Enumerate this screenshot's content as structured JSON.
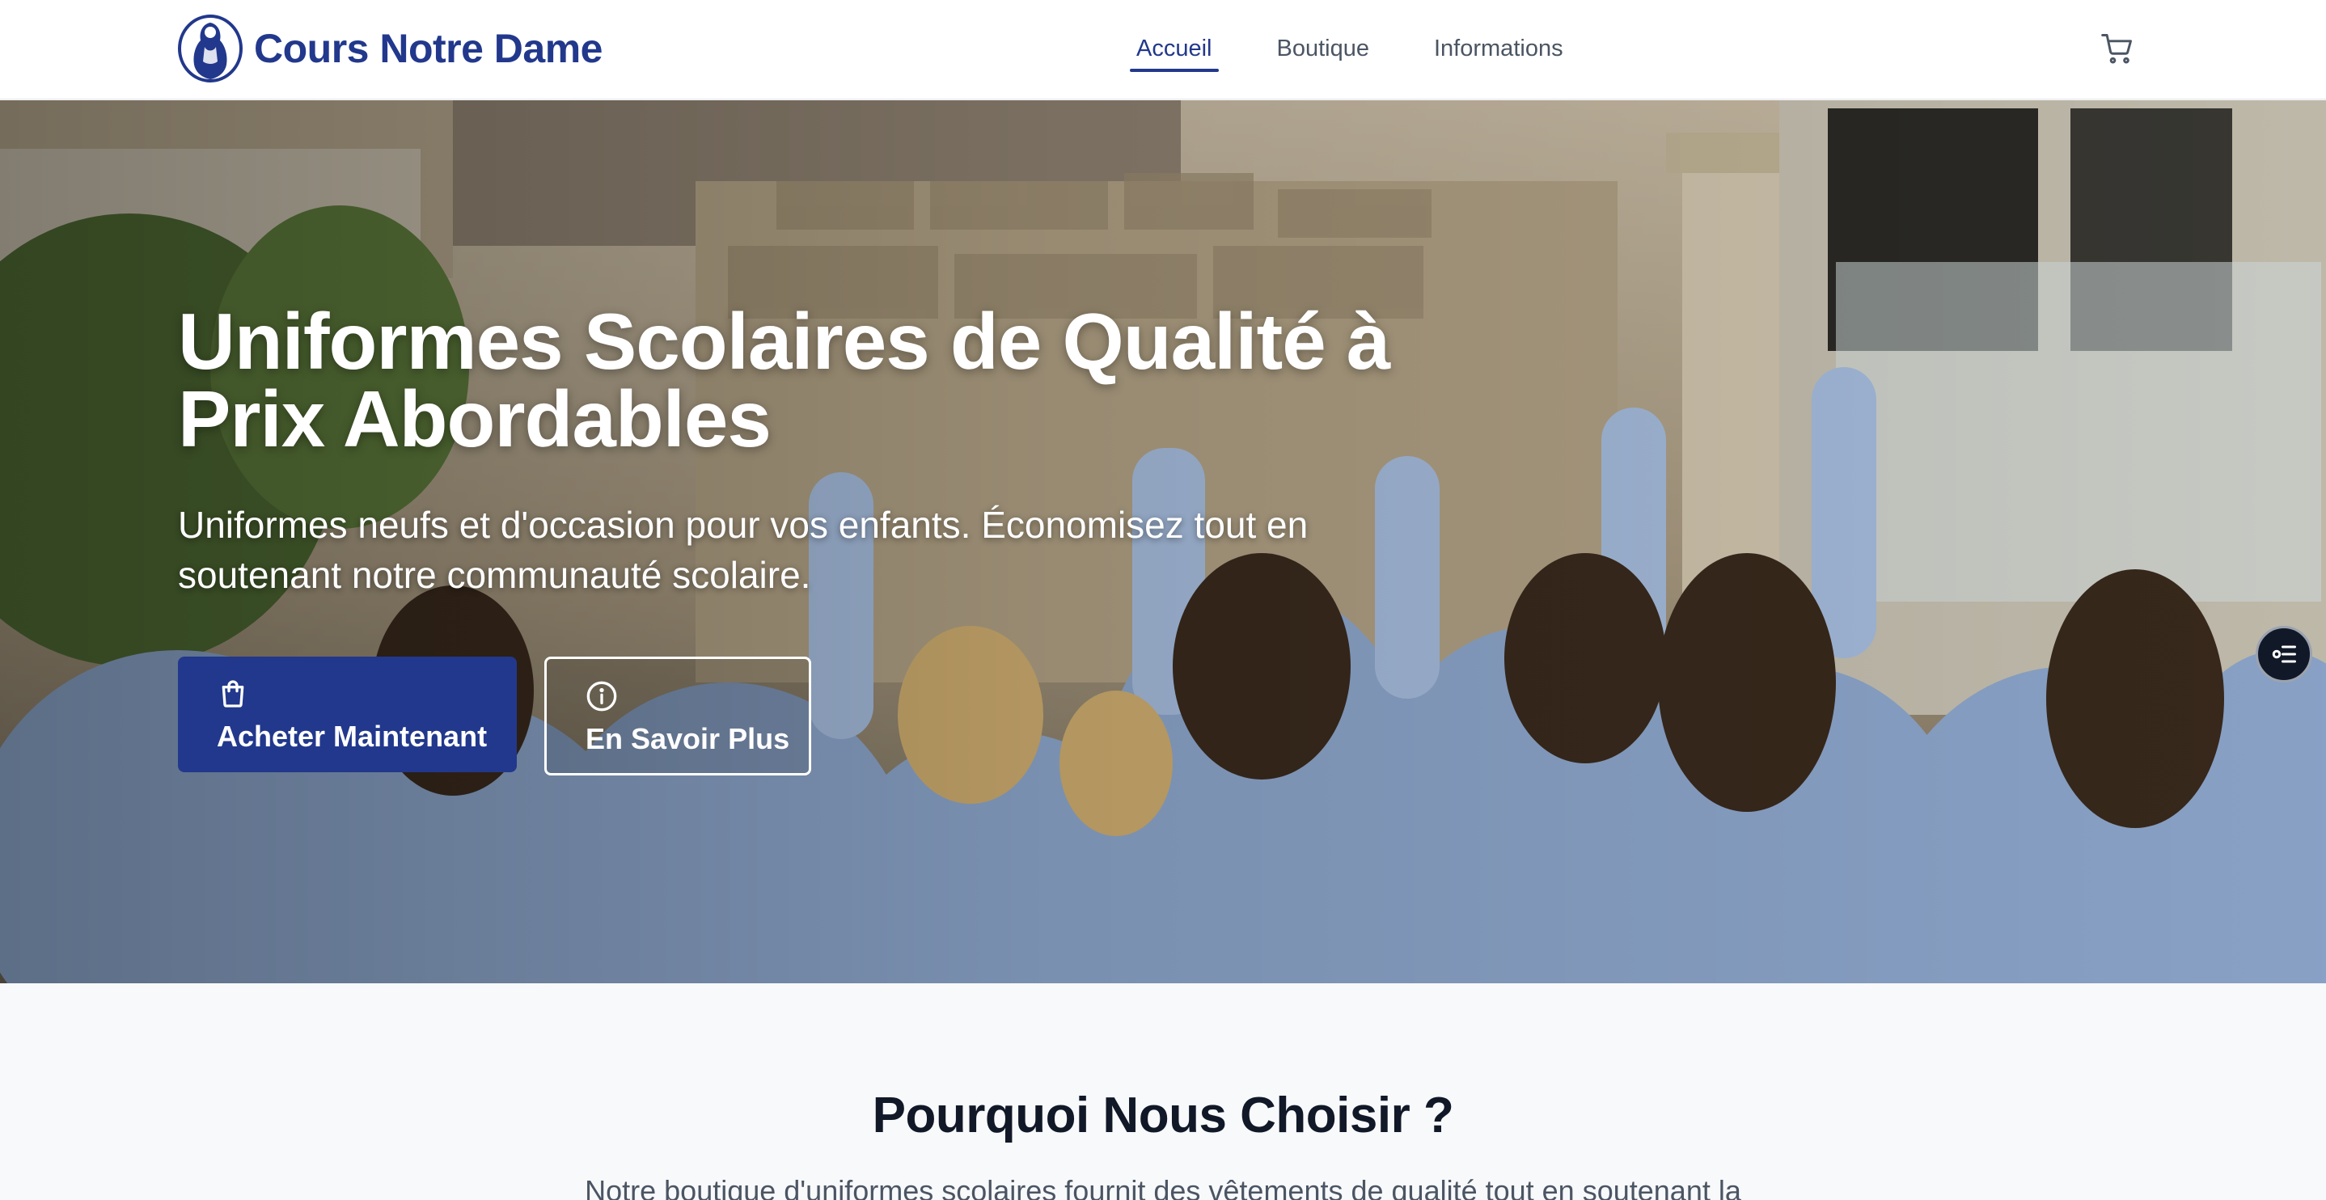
{
  "brand": {
    "name": "Cours Notre Dame",
    "logo_icon": "madonna-logo-icon",
    "color": "#22388c"
  },
  "nav": {
    "items": [
      {
        "label": "Accueil",
        "active": true
      },
      {
        "label": "Boutique",
        "active": false
      },
      {
        "label": "Informations",
        "active": false
      }
    ],
    "cart_icon": "cart-icon"
  },
  "hero": {
    "title": "Uniformes Scolaires de Qualité à Prix Abordables",
    "subtitle": "Uniformes neufs et d'occasion pour vos enfants. Économisez tout en soutenant notre communauté scolaire.",
    "primary_button": {
      "label": "Acheter Maintenant",
      "icon": "shopping-bag-icon"
    },
    "secondary_button": {
      "label": "En Savoir Plus",
      "icon": "info-icon"
    },
    "background_description_icon": "students-courtyard-photo",
    "fab_icon": "filter-list-icon"
  },
  "why": {
    "title": "Pourquoi Nous Choisir ?",
    "text": "Notre boutique d'uniformes scolaires fournit des vêtements de qualité tout en soutenant la"
  },
  "colors": {
    "primary": "#22388c",
    "text_dark": "#111827",
    "text_muted": "#4b5563",
    "background": "#f8f9fb"
  }
}
